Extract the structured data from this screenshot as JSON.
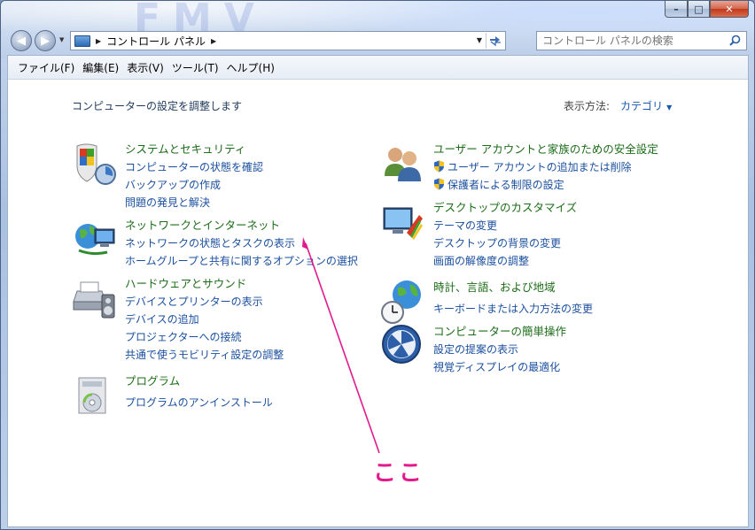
{
  "window": {
    "minimize_glyph": "–",
    "maximize_glyph": "□",
    "close_glyph": "✕"
  },
  "decoration": {
    "background_letters": "FMV"
  },
  "nav": {
    "back_glyph": "◀",
    "forward_glyph": "▶",
    "address": {
      "path": "コントロール パネル",
      "separator": "▶"
    },
    "refresh_icon": "refresh-icon",
    "search": {
      "placeholder": "コントロール パネルの検索"
    }
  },
  "menubar": {
    "items": [
      {
        "label": "ファイル(F)"
      },
      {
        "label": "編集(E)"
      },
      {
        "label": "表示(V)"
      },
      {
        "label": "ツール(T)"
      },
      {
        "label": "ヘルプ(H)"
      }
    ]
  },
  "main": {
    "title": "コンピューターの設定を調整します",
    "view_by": {
      "label": "表示方法:",
      "value": "カテゴリ",
      "dropdown_glyph": "▼"
    }
  },
  "categories_left": [
    {
      "icon": "system-security-icon",
      "heading": "システムとセキュリティ",
      "links": [
        "コンピューターの状態を確認",
        "バックアップの作成",
        "問題の発見と解決"
      ]
    },
    {
      "icon": "network-icon",
      "heading": "ネットワークとインターネット",
      "links": [
        "ネットワークの状態とタスクの表示",
        "ホームグループと共有に関するオプションの選択"
      ]
    },
    {
      "icon": "hardware-sound-icon",
      "heading": "ハードウェアとサウンド",
      "links": [
        "デバイスとプリンターの表示",
        "デバイスの追加",
        "プロジェクターへの接続",
        "共通で使うモビリティ設定の調整"
      ]
    },
    {
      "icon": "programs-icon",
      "heading": "プログラム",
      "links": [
        "プログラムのアンインストール"
      ]
    }
  ],
  "categories_right": [
    {
      "icon": "user-accounts-icon",
      "heading": "ユーザー アカウントと家族のための安全設定",
      "links": [
        "ユーザー アカウントの追加または削除",
        "保護者による制限の設定"
      ]
    },
    {
      "icon": "appearance-icon",
      "heading": "デスクトップのカスタマイズ",
      "links": [
        "テーマの変更",
        "デスクトップの背景の変更",
        "画面の解像度の調整"
      ]
    },
    {
      "icon": "clock-region-icon",
      "heading": "時計、言語、および地域",
      "links": [
        "キーボードまたは入力方法の変更"
      ]
    },
    {
      "icon": "ease-of-access-icon",
      "heading": "コンピューターの簡単操作",
      "links": [
        "設定の提案の表示",
        "視覚ディスプレイの最適化"
      ]
    }
  ],
  "annotation": {
    "text": "ここ",
    "color": "#e21a8c"
  },
  "colors": {
    "heading_green": "#1c6d18",
    "link_blue": "#1a4f9e",
    "title_navy": "#1e395b"
  }
}
